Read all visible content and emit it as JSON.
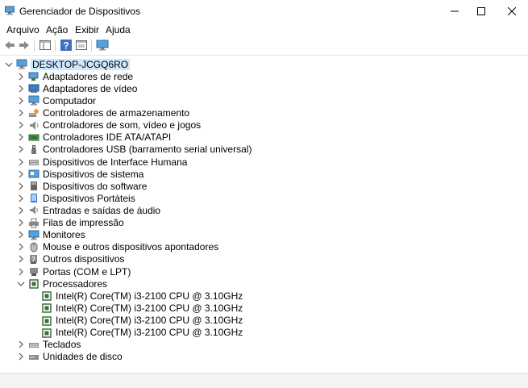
{
  "window": {
    "title": "Gerenciador de Dispositivos",
    "icon": "device-manager-icon"
  },
  "menu": [
    "Arquivo",
    "Ação",
    "Exibir",
    "Ajuda"
  ],
  "toolbar": [
    "back-icon",
    "forward-icon",
    "properties-pane-icon",
    "help-icon",
    "view-details-icon",
    "scan-monitor-icon"
  ],
  "tree": {
    "root": {
      "label": "DESKTOP-JCGQ6RO",
      "icon": "computer-icon",
      "expanded": true
    },
    "categories": [
      {
        "label": "Adaptadores de rede",
        "icon": "network-adapter-icon"
      },
      {
        "label": "Adaptadores de vídeo",
        "icon": "display-adapter-icon"
      },
      {
        "label": "Computador",
        "icon": "computer-icon"
      },
      {
        "label": "Controladores de armazenamento",
        "icon": "storage-controller-icon"
      },
      {
        "label": "Controladores de som, vídeo e jogos",
        "icon": "speaker-icon"
      },
      {
        "label": "Controladores IDE ATA/ATAPI",
        "icon": "ide-controller-icon"
      },
      {
        "label": "Controladores USB (barramento serial universal)",
        "icon": "usb-icon"
      },
      {
        "label": "Dispositivos de Interface Humana",
        "icon": "hid-icon"
      },
      {
        "label": "Dispositivos de sistema",
        "icon": "system-device-icon"
      },
      {
        "label": "Dispositivos do software",
        "icon": "software-device-icon"
      },
      {
        "label": "Dispositivos Portáteis",
        "icon": "portable-device-icon"
      },
      {
        "label": "Entradas e saídas de áudio",
        "icon": "audio-io-icon"
      },
      {
        "label": "Filas de impressão",
        "icon": "printer-icon"
      },
      {
        "label": "Monitores",
        "icon": "monitor-icon"
      },
      {
        "label": "Mouse e outros dispositivos apontadores",
        "icon": "mouse-icon"
      },
      {
        "label": "Outros dispositivos",
        "icon": "unknown-device-icon"
      },
      {
        "label": "Portas (COM e LPT)",
        "icon": "port-icon"
      },
      {
        "label": "Processadores",
        "icon": "processor-icon",
        "expanded": true,
        "children": [
          "Intel(R) Core(TM) i3-2100 CPU @ 3.10GHz",
          "Intel(R) Core(TM) i3-2100 CPU @ 3.10GHz",
          "Intel(R) Core(TM) i3-2100 CPU @ 3.10GHz",
          "Intel(R) Core(TM) i3-2100 CPU @ 3.10GHz"
        ]
      },
      {
        "label": "Teclados",
        "icon": "keyboard-icon"
      },
      {
        "label": "Unidades de disco",
        "icon": "disk-drive-icon"
      }
    ]
  }
}
